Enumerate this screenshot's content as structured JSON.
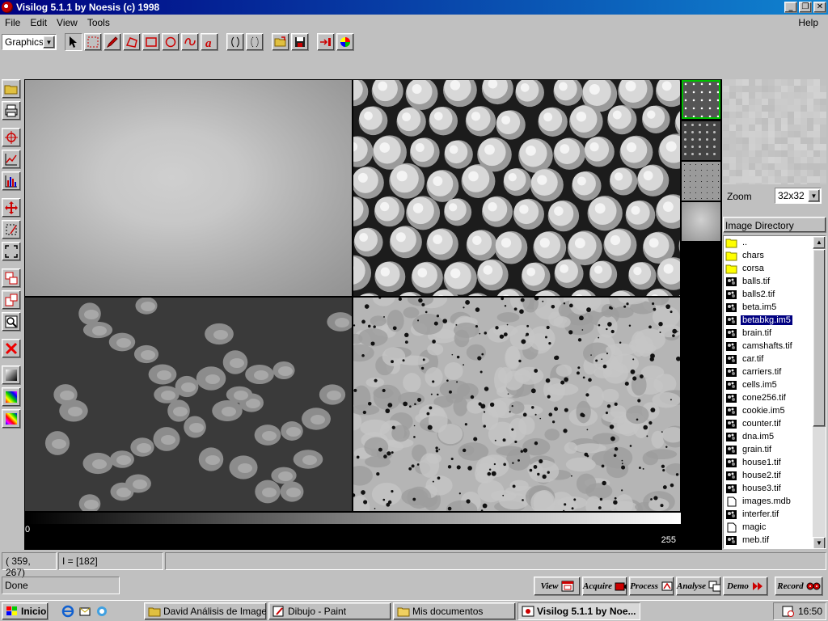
{
  "window": {
    "title": "Visilog 5.1.1 by Noesis (c) 1998"
  },
  "menu": {
    "items": [
      "File",
      "Edit",
      "View",
      "Tools"
    ],
    "help": "Help"
  },
  "toolbar": {
    "mode_select": "Graphics"
  },
  "gray_scale": {
    "min_label": "0",
    "max_label": "255"
  },
  "zoom": {
    "label": "Zoom",
    "value": "32x32"
  },
  "directory": {
    "header": "Image Directory",
    "items": [
      {
        "name": "..",
        "type": "folder"
      },
      {
        "name": "chars",
        "type": "folder"
      },
      {
        "name": "corsa",
        "type": "folder"
      },
      {
        "name": "balls.tif",
        "type": "image"
      },
      {
        "name": "balls2.tif",
        "type": "image"
      },
      {
        "name": "beta.im5",
        "type": "image"
      },
      {
        "name": "betabkg.im5",
        "type": "image",
        "selected": true
      },
      {
        "name": "brain.tif",
        "type": "image"
      },
      {
        "name": "camshafts.tif",
        "type": "image"
      },
      {
        "name": "car.tif",
        "type": "image"
      },
      {
        "name": "carriers.tif",
        "type": "image"
      },
      {
        "name": "cells.im5",
        "type": "image"
      },
      {
        "name": "cone256.tif",
        "type": "image"
      },
      {
        "name": "cookie.im5",
        "type": "image"
      },
      {
        "name": "counter.tif",
        "type": "image"
      },
      {
        "name": "dna.im5",
        "type": "image"
      },
      {
        "name": "grain.tif",
        "type": "image"
      },
      {
        "name": "house1.tif",
        "type": "image"
      },
      {
        "name": "house2.tif",
        "type": "image"
      },
      {
        "name": "house3.tif",
        "type": "image"
      },
      {
        "name": "images.mdb",
        "type": "file"
      },
      {
        "name": "interfer.tif",
        "type": "image"
      },
      {
        "name": "magic",
        "type": "file"
      },
      {
        "name": "meb.tif",
        "type": "image"
      }
    ]
  },
  "status": {
    "coords": "( 359, 267)",
    "intensity": "I = [182]",
    "message": "Done"
  },
  "actions": {
    "view": "View",
    "acquire": "Acquire",
    "process": "Process",
    "analyse": "Analyse",
    "demo": "Demo",
    "record": "Record"
  },
  "taskbar": {
    "start": "Inicio",
    "tasks": [
      "David Análisis de Imagen",
      "Dibujo - Paint",
      "Mis documentos",
      "Visilog 5.1.1 by Noe..."
    ],
    "clock": "16:50"
  },
  "colors": {
    "title_start": "#000080",
    "title_end": "#1084d0",
    "selection": "#000080",
    "thumb_active_border": "#00c000"
  }
}
